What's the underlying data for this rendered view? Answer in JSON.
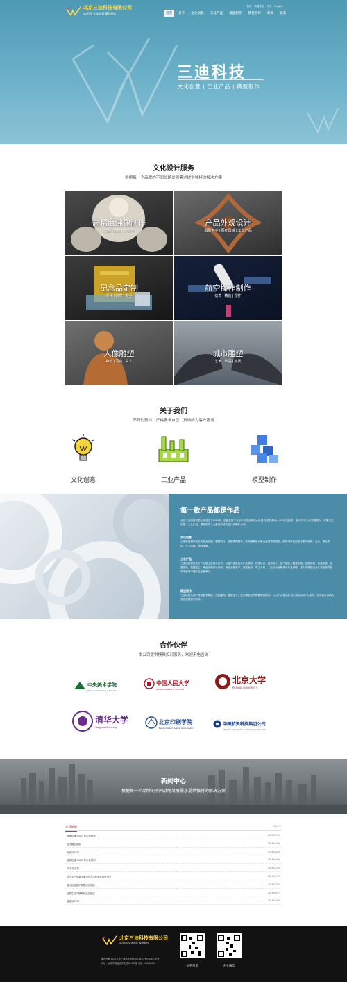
{
  "header": {
    "logo_name": "北京三迪科技有限公司",
    "logo_sub": "3D打印 文化创意 模型制作",
    "top_links": [
      "首页",
      "收藏本站",
      "中文",
      "English"
    ],
    "nav": [
      "首页",
      "关于",
      "文化创意",
      "工业产品",
      "模型制作",
      "教育合作",
      "新闻",
      "联系"
    ],
    "active_index": 0
  },
  "hero": {
    "title": "三迪科技",
    "subtitle": "文化创意 | 工业产品 | 模型制作"
  },
  "services": {
    "title": "文化设计服务",
    "subtitle": "根据每一个品牌的不同战略发展需求提供独特的解决方案",
    "tiles": [
      {
        "title": "高精度佛像制作",
        "sub": "扫描 | 修复 | 3D打印"
      },
      {
        "title": "产品外观设计",
        "sub": "消费电子 | 医疗器械 | 工业产品"
      },
      {
        "title": "纪念品定制",
        "sub": "设计 | 创意 | 专业"
      },
      {
        "title": "航空操作制作",
        "sub": "仿真 | 精装 | 摆件"
      },
      {
        "title": "人像雕塑",
        "sub": "神韵 | 写真 | 真人"
      },
      {
        "title": "城市雕塑",
        "sub": "艺术 | 饰品 | 礼武"
      }
    ]
  },
  "about": {
    "title": "关于我们",
    "subtitle": "不断的努力，严格要求自己，真诚的为客户服务",
    "icons": [
      {
        "label": "文化创意",
        "icon": "lightbulb-icon"
      },
      {
        "label": "工业产品",
        "icon": "factory-icon"
      },
      {
        "label": "模型制作",
        "icon": "cubes-icon"
      }
    ],
    "panel_title": "每一款产品都是作品",
    "intro": "北京三迪科技有限公司成立于2013年，总部坐落于北京市科技创新核心区域-中关村高地，6年间迅速成一家3D打印公司发展成为一家集文化创意、工业产品、模型制作三大板块的综合设计及制作公司。",
    "sections": [
      {
        "heading": "文化创意",
        "text": "三迪科技提供专业的礼品定制，雕塑设计，高精佛像制作，影视道具设计等文化创意类服务。服务对象包括但不限于政府、企业、事业单位、个人收藏、博物馆等。"
      },
      {
        "heading": "工业产品",
        "text": "三迪科技提供设计产业链上的综合实力，为客户提供包含产品调研、外观设计、结构设计、生产制造（模具制造、注塑成型、钣金制造、金属压铸、机械加工）等全流程设计服务。涉及消费电子、家居医疗、车工卡吊，工业自动化等多个产品领域。致力于帮助企业实现创新并在市场竞争中提升企业竞争力。"
      },
      {
        "heading": "模型制作",
        "text": "三迪科技为客户提供数字展板、扫描建构、模型加工、医疗模型制作等模型类服务。以以下以推出的“设计驱动创新”为使命，在中国以实践为领先的模型制作商。"
      }
    ]
  },
  "partners": {
    "title": "合作伙伴",
    "subtitle": "本公司提供模具设计服务，欢迎来电咨询",
    "logos": [
      {
        "name": "中央美术学院",
        "en": "China Central Academy of Fine Arts",
        "color": "#1f6b3a"
      },
      {
        "name": "中国人民大学",
        "en": "RENMIN UNIVERSITY OF CHINA",
        "color": "#a3162a"
      },
      {
        "name": "北京大学",
        "en": "PEKING UNIVERSITY",
        "color": "#8b1a1a"
      },
      {
        "name": "清华大学",
        "en": "Tsinghua University",
        "color": "#6b2c8f"
      },
      {
        "name": "北京印刷学院",
        "en": "Beijing Institute Of Graphic Communication",
        "color": "#1f4e8f"
      },
      {
        "name": "中国航天科技集团公司",
        "en": "China Aerospace Science and Technology Corporation",
        "color": "#1b3f8a"
      }
    ]
  },
  "news": {
    "title": "新闻中心",
    "subtitle": "根据每一个品牌的不同战略发展需求提供独特的解决方案",
    "tab": "公司新闻",
    "more": "MORE",
    "items": [
      {
        "title": "准确机器人3D打印彩色样例",
        "date": "2018/01/19"
      },
      {
        "title": "医疗模型定制",
        "date": "2018/01/06"
      },
      {
        "title": "北京3D打印",
        "date": "2018/01/09"
      },
      {
        "title": "准确机器人3D打印彩色样例",
        "date": "2018/01/06"
      },
      {
        "title": "3D打印应用",
        "date": "2018/01/04"
      },
      {
        "title": "给卡卡一件事子事业的生活的就非接受采访",
        "date": "2018/01/17"
      },
      {
        "title": "通州区鼓励护捕需创业协助",
        "date": "2018/01/06"
      },
      {
        "title": "还想生活中哪种精品曲放送",
        "date": "2018/06/27"
      },
      {
        "title": "碰碰3D打印",
        "date": "2018/01/06"
      }
    ]
  },
  "footer": {
    "name": "北京三迪科技有限公司",
    "sub": "3D打印 文化创意 模型制作",
    "line1": "版权所有 2014 北京三迪科技有限公司 京ICP备15051740号",
    "line2": "地址：北京市海淀区东北旺4G-503室  电话：010-59650",
    "qr1_label": "业务咨询",
    "qr2_label": "企业微信"
  }
}
